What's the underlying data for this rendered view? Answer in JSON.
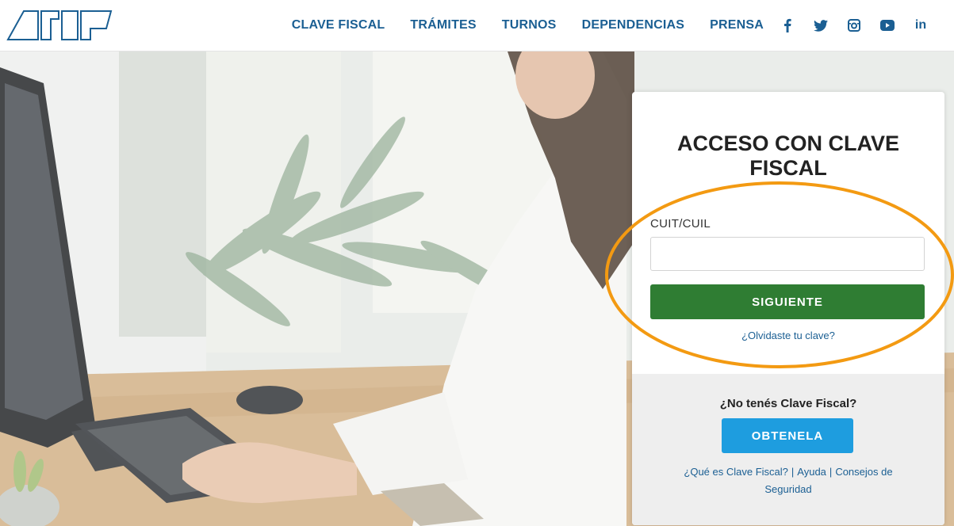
{
  "nav": {
    "items": [
      {
        "label": "CLAVE FISCAL"
      },
      {
        "label": "TRÁMITES"
      },
      {
        "label": "TURNOS"
      },
      {
        "label": "DEPENDENCIAS"
      },
      {
        "label": "PRENSA"
      }
    ],
    "social": [
      "facebook-icon",
      "twitter-icon",
      "instagram-icon",
      "youtube-icon",
      "linkedin-icon"
    ],
    "linkedin_text": "in"
  },
  "login": {
    "title": "ACCESO CON CLAVE FISCAL",
    "field_label": "CUIT/CUIL",
    "field_value": "",
    "next_button": "SIGUIENTE",
    "forgot_link": "¿Olvidaste tu clave?"
  },
  "signup": {
    "question": "¿No tenés Clave Fiscal?",
    "get_button": "OBTENELA",
    "links": [
      {
        "label": "¿Qué es Clave Fiscal?"
      },
      {
        "label": "Ayuda"
      },
      {
        "label": "Consejos de Seguridad"
      }
    ],
    "separator": "|"
  },
  "colors": {
    "nav_text": "#1b5f93",
    "next_button": "#2f7d33",
    "get_button": "#1e9ddf",
    "highlight": "#f39a12"
  }
}
